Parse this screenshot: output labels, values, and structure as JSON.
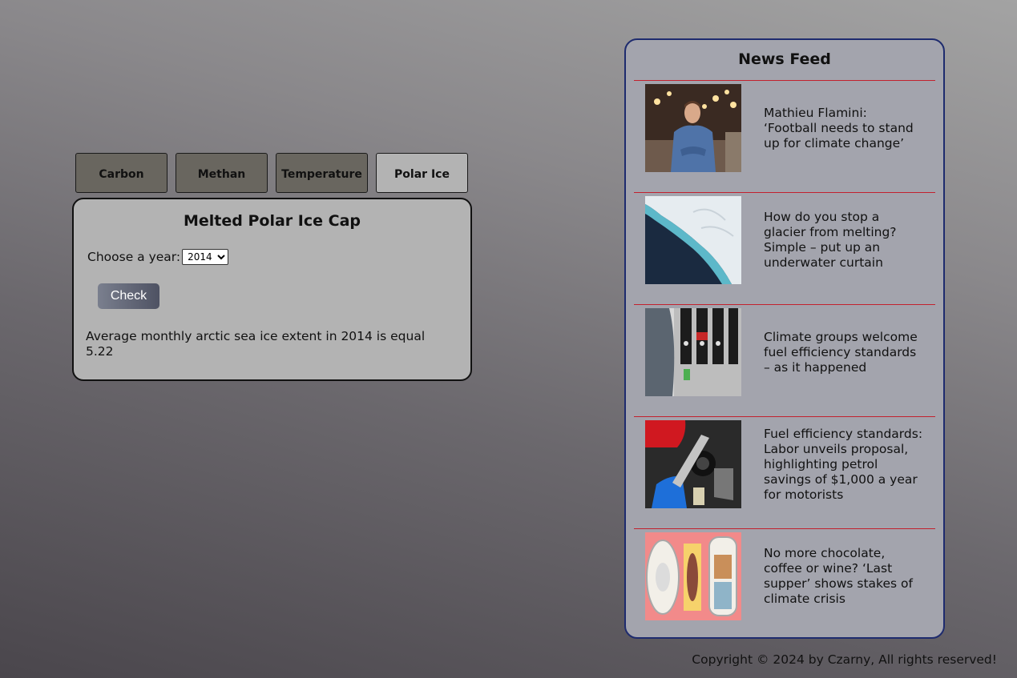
{
  "tabs": [
    {
      "label": "Carbon"
    },
    {
      "label": "Methan"
    },
    {
      "label": "Temperature"
    },
    {
      "label": "Polar Ice"
    }
  ],
  "panel": {
    "title": "Melted Polar Ice Cap",
    "year_label": "Choose a year:",
    "selected_year": "2014",
    "check_label": "Check",
    "result": "Average monthly arctic sea ice extent in 2014 is equal 5.22"
  },
  "news": {
    "title": "News Feed",
    "items": [
      {
        "headline": "Mathieu Flamini: ‘Football needs to stand up for climate change’",
        "thumb": "man-in-restaurant-photo"
      },
      {
        "headline": "How do you stop a glacier from melting? Simple – put up an underwater curtain",
        "thumb": "glacier-aerial-photo"
      },
      {
        "headline": "Climate groups welcome fuel efficiency standards – as it happened",
        "thumb": "fuel-pump-nozzles-photo"
      },
      {
        "headline": "Fuel efficiency standards: Labor unveils proposal, highlighting petrol savings of $1,000 a year for motorists",
        "thumb": "refuelling-car-photo"
      },
      {
        "headline": "No more chocolate, coffee or wine? ‘Last supper’ shows stakes of climate crisis",
        "thumb": "last-supper-plates-photo"
      }
    ]
  },
  "footer": {
    "copyright": "Copyright © 2024 by Czarny, All rights reserved!"
  }
}
